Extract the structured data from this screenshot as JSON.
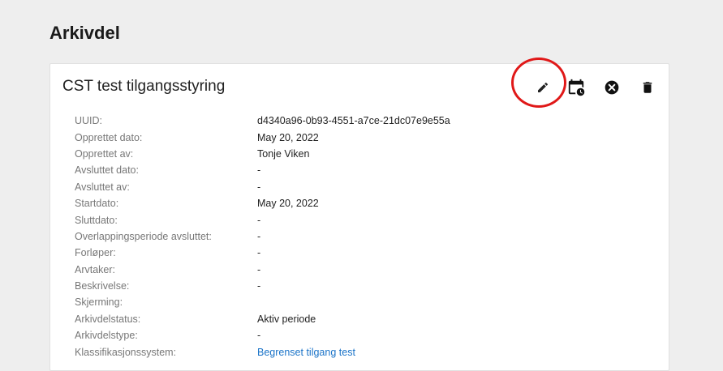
{
  "page": {
    "title": "Arkivdel"
  },
  "card": {
    "title": "CST test tilgangsstyring",
    "actions": [
      {
        "name": "edit-icon"
      },
      {
        "name": "calendar-clock-icon"
      },
      {
        "name": "close-circle-icon"
      },
      {
        "name": "trash-icon"
      }
    ]
  },
  "properties": [
    {
      "label": "UUID:",
      "value": "d4340a96-0b93-4551-a7ce-21dc07e9e55a"
    },
    {
      "label": "Opprettet dato:",
      "value": "May 20, 2022"
    },
    {
      "label": "Opprettet av:",
      "value": "Tonje Viken"
    },
    {
      "label": "Avsluttet dato:",
      "value": "-"
    },
    {
      "label": "Avsluttet av:",
      "value": "-"
    },
    {
      "label": "Startdato:",
      "value": "May 20, 2022"
    },
    {
      "label": "Sluttdato:",
      "value": "-"
    },
    {
      "label": "Overlappingsperiode avsluttet:",
      "value": "-"
    },
    {
      "label": "Forløper:",
      "value": "-"
    },
    {
      "label": "Arvtaker:",
      "value": "-"
    },
    {
      "label": "Beskrivelse:",
      "value": "-"
    },
    {
      "label": "Skjerming:",
      "value": ""
    },
    {
      "label": "Arkivdelstatus:",
      "value": "Aktiv periode"
    },
    {
      "label": "Arkivdelstype:",
      "value": "-"
    },
    {
      "label": "Klassifikasjonssystem:",
      "value": "Begrenset tilgang test"
    }
  ],
  "colors": {
    "highlight": "#e01818",
    "link": "#1a73c8"
  }
}
